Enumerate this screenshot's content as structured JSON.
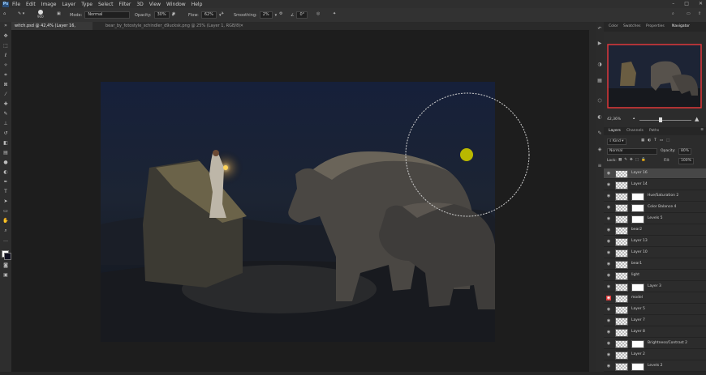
{
  "app": {
    "logo": "Ps",
    "menu": [
      "File",
      "Edit",
      "Image",
      "Layer",
      "Type",
      "Select",
      "Filter",
      "3D",
      "View",
      "Window",
      "Help"
    ]
  },
  "options_bar": {
    "brush_size": "900",
    "mode_label": "Mode:",
    "mode_value": "Normal",
    "opacity_label": "Opacity:",
    "opacity_value": "30%",
    "flow_label": "Flow:",
    "flow_value": "62%",
    "smoothing_label": "Smoothing:",
    "smoothing_value": "2%",
    "angle_value": "0°"
  },
  "document_tabs": [
    {
      "label": "witch.psd @ 42,4% (Layer 16, RGB/8) *",
      "active": true
    },
    {
      "label": "bear_by_fotostyle_schindler_d9ucksk.png @ 25% (Layer 1, RGB/8)",
      "active": false
    }
  ],
  "right_panel": {
    "tabs": [
      "Color",
      "Swatches",
      "Properties",
      "Navigator"
    ],
    "active_tab": "Navigator",
    "zoom": "42,36%",
    "layers_tabs": [
      "Layers",
      "Channels",
      "Paths"
    ],
    "kind_label": "Kind",
    "blend_mode": "Normal",
    "opacity_label": "Opacity:",
    "opacity_value": "80%",
    "lock_label": "Lock:",
    "fill_label": "Fill:",
    "fill_value": "100%"
  },
  "layers": [
    {
      "name": "Layer 16",
      "selected": true,
      "mask": false
    },
    {
      "name": "Layer 14",
      "selected": false,
      "mask": false
    },
    {
      "name": "Hue/Saturation 2",
      "selected": false,
      "mask": true
    },
    {
      "name": "Color Balance 4",
      "selected": false,
      "mask": true
    },
    {
      "name": "Levels 5",
      "selected": false,
      "mask": true
    },
    {
      "name": "bear2",
      "selected": false,
      "mask": false
    },
    {
      "name": "Layer 13",
      "selected": false,
      "mask": false
    },
    {
      "name": "Layer 10",
      "selected": false,
      "mask": false
    },
    {
      "name": "bear1",
      "selected": false,
      "mask": false
    },
    {
      "name": "light",
      "selected": false,
      "mask": false
    },
    {
      "name": "Layer 3",
      "selected": false,
      "mask": true
    },
    {
      "name": "model",
      "selected": false,
      "mask": false
    },
    {
      "name": "Layer 5",
      "selected": false,
      "mask": false
    },
    {
      "name": "Layer 7",
      "selected": false,
      "mask": false
    },
    {
      "name": "Layer 8",
      "selected": false,
      "mask": false
    },
    {
      "name": "Brightness/Contrast 2",
      "selected": false,
      "mask": true
    },
    {
      "name": "Layer 2",
      "selected": false,
      "mask": false
    },
    {
      "name": "Levels 2",
      "selected": false,
      "mask": true
    }
  ],
  "colors": {
    "accent_red": "#e23a3a",
    "brush_cursor": "#b9b800",
    "night_sky": "#1b2333"
  }
}
